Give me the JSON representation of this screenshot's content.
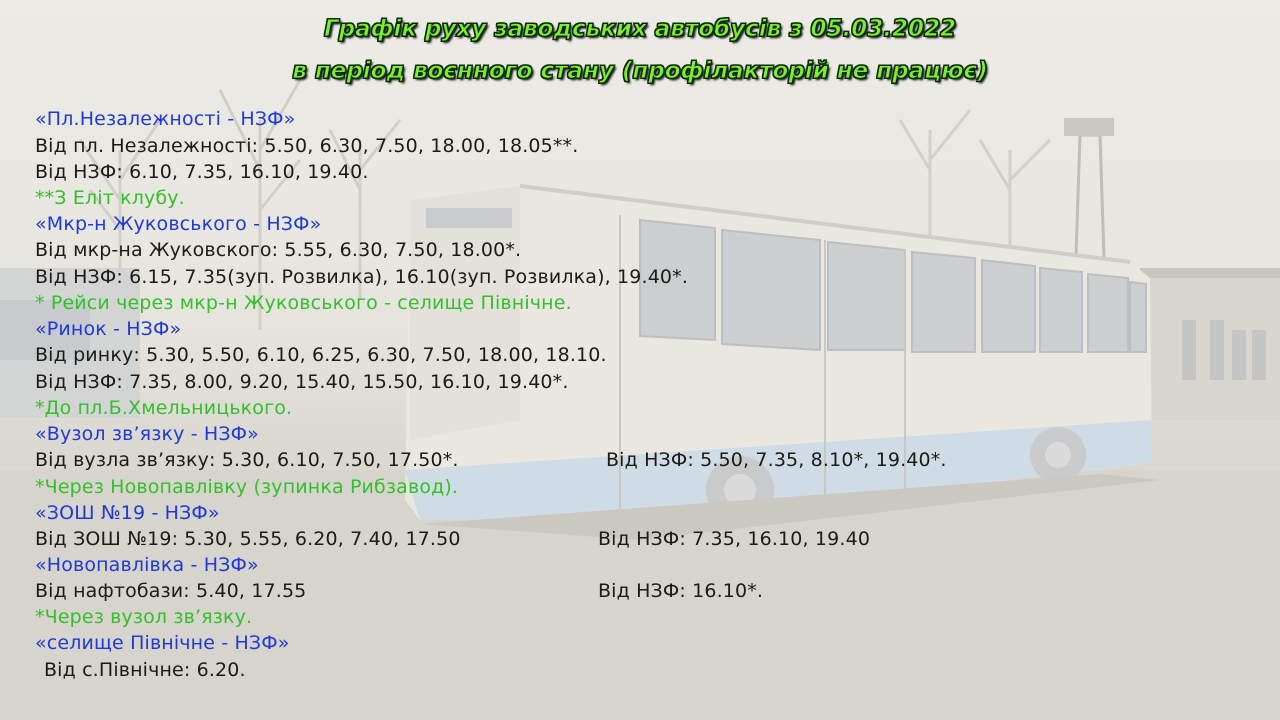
{
  "header": {
    "title_line1": "Графік руху заводських автобусів з 05.03.2022",
    "title_line2": "в період воєнного стану (профілакторій не працює)"
  },
  "routes": [
    {
      "name": "«Пл.Незалежності - НЗФ»",
      "from": "Від пл. Незалежності: 5.50, 6.30, 7.50, 18.00, 18.05**.",
      "back": "Від НЗФ: 6.10, 7.35, 16.10, 19.40.",
      "note": "**З Еліт клубу."
    },
    {
      "name": "«Мкр-н Жуковського - НЗФ»",
      "from": "Від мкр-на Жуковского: 5.55, 6.30, 7.50, 18.00*.",
      "back": "Від НЗФ: 6.15, 7.35(зуп. Розвилка), 16.10(зуп. Розвилка), 19.40*.",
      "note": "* Рейси через мкр-н Жуковського - селище Північне."
    },
    {
      "name": "«Ринок - НЗФ»",
      "from": "Від ринку: 5.30, 5.50, 6.10, 6.25, 6.30, 7.50, 18.00, 18.10.",
      "back": "Від НЗФ: 7.35, 8.00, 9.20, 15.40, 15.50, 16.10, 19.40*.",
      "note": "*До пл.Б.Хмельницького."
    },
    {
      "name": "«Вузол зв’язку - НЗФ»",
      "from": "Від вузла зв’язку: 5.30, 6.10, 7.50, 17.50*.",
      "back": "Від НЗФ: 5.50, 7.35, 8.10*, 19.40*.",
      "note": "*Через Новопавлівку (зупинка Рибзавод)."
    },
    {
      "name": "«ЗОШ №19 - НЗФ»",
      "from": "Від ЗОШ №19: 5.30, 5.55, 6.20, 7.40, 17.50",
      "back": "Від НЗФ:  7.35, 16.10, 19.40"
    },
    {
      "name": "«Новопавлівка - НЗФ»",
      "from": "Від нафтобази: 5.40, 17.55",
      "back": "Від НЗФ: 16.10*.",
      "note": "*Через вузол зв’язку."
    },
    {
      "name": "«селище Північне - НЗФ»",
      "from": "Від с.Північне: 6.20."
    }
  ],
  "colors": {
    "title": "#7cf02c",
    "route": "#1f3ad8",
    "times": "#1c1c14",
    "note": "#33c02a"
  },
  "background": {
    "subject": "bus-photo"
  }
}
